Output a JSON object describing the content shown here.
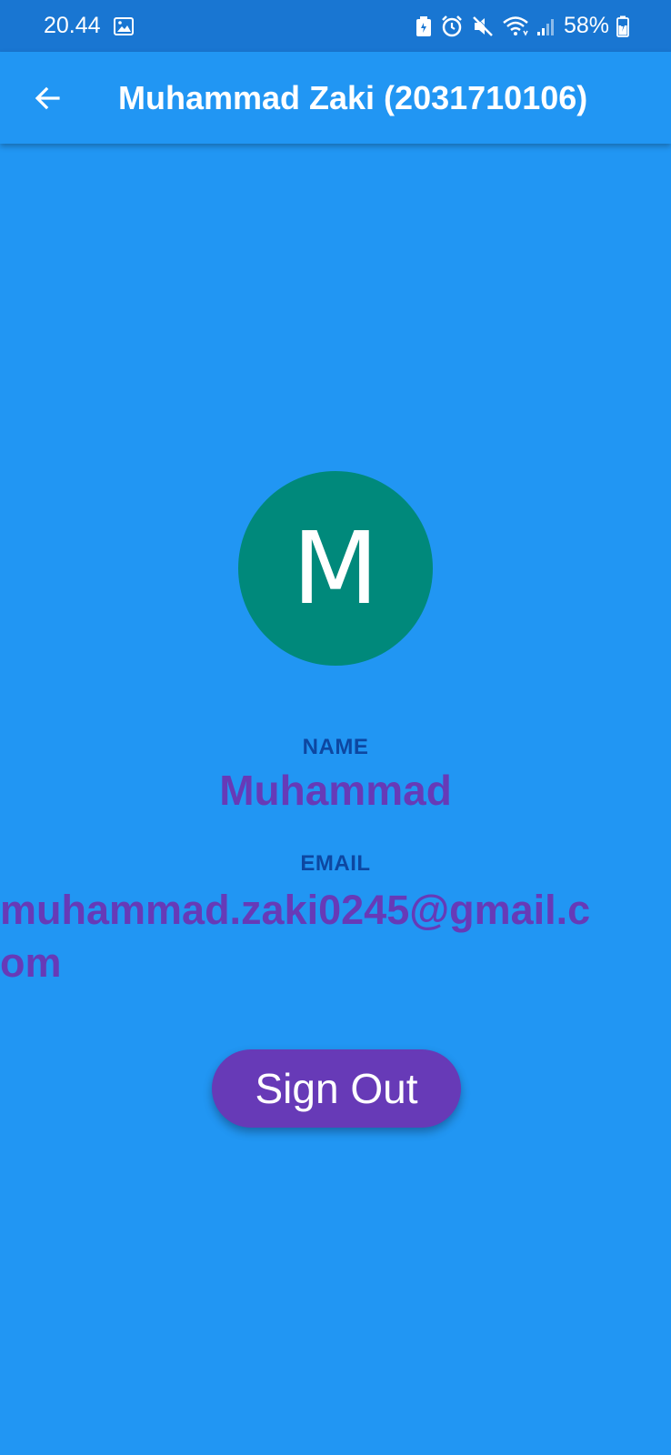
{
  "status_bar": {
    "time": "20.44",
    "battery_percent": "58%",
    "icons": [
      "image-icon",
      "battery-saver-icon",
      "alarm-icon",
      "mute-icon",
      "wifi-icon",
      "signal-icon",
      "battery-icon"
    ]
  },
  "app_bar": {
    "title": "Muhammad Zaki (2031710106)",
    "back_icon": "arrow-back-icon"
  },
  "profile": {
    "avatar_letter": "M",
    "avatar_color": "#00897B",
    "name_label": "NAME",
    "name": "Muhammad",
    "email_label": "EMAIL",
    "email": "muhammad.zaki0245@gmail.com"
  },
  "actions": {
    "sign_out_label": "Sign Out"
  },
  "colors": {
    "background": "#2196F3",
    "status_bar": "#1976D2",
    "accent": "#673AB7",
    "label": "#0D47A1"
  }
}
